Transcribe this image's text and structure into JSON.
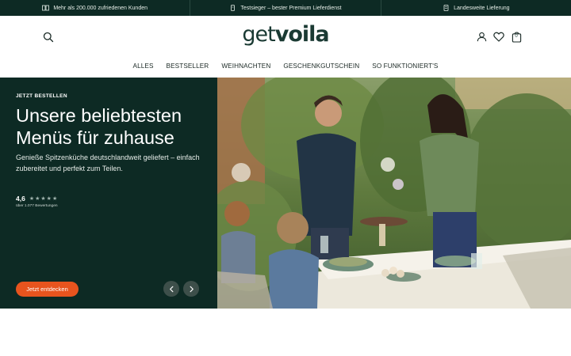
{
  "topbar": {
    "items": [
      {
        "icon": "customers-icon",
        "text": "Mehr als 200.000 zufriedenen Kunden"
      },
      {
        "icon": "award-icon",
        "text": "Testsieger – bester Premium Lieferdienst"
      },
      {
        "icon": "truck-icon",
        "text": "Landesweite Lieferung"
      }
    ]
  },
  "header": {
    "logo_light": "get",
    "logo_bold": "voila",
    "cart_count": "0"
  },
  "nav": {
    "items": [
      "ALLES",
      "BESTSELLER",
      "WEIHNACHTEN",
      "GESCHENKGUTSCHEIN",
      "SO FUNKTIONIERT'S"
    ]
  },
  "hero": {
    "eyebrow": "JETZT BESTELLEN",
    "headline": "Unsere beliebtesten Menüs für zuhause",
    "subtext": "Genieße Spitzenküche deutschlandweit geliefert – einfach zubereitet und perfekt zum Teilen.",
    "rating_value": "4,6",
    "rating_stars": 4.6,
    "reviews": "über 1.077 Bewertungen",
    "cta_label": "Jetzt entdecken",
    "image": "family-dinner-garden-photo"
  },
  "colors": {
    "dark_green": "#0d2a24",
    "accent_orange": "#e8541e",
    "arrow_bg": "#3d4f4a"
  }
}
